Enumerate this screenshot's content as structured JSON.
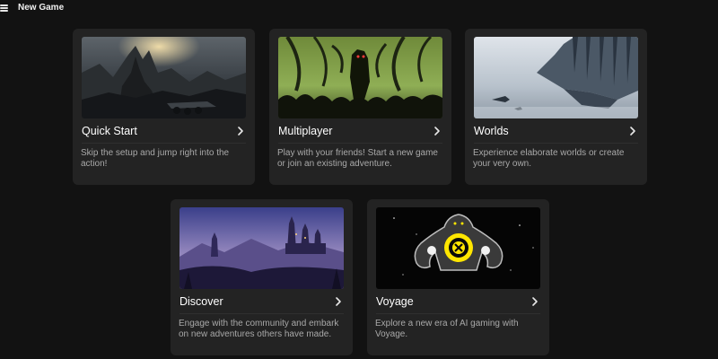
{
  "header": {
    "menu_icon": "hamburger-icon",
    "title": "New Game"
  },
  "cards": [
    {
      "title": "Quick Start",
      "description": "Skip the setup and jump right into the action!",
      "image": "dark-mountain-city-illustration",
      "chevron_icon": "chevron-right-icon"
    },
    {
      "title": "Multiplayer",
      "description": "Play with your friends! Start a new game or join an existing adventure.",
      "image": "tentacle-monster-crowd-illustration",
      "chevron_icon": "chevron-right-icon"
    },
    {
      "title": "Worlds",
      "description": "Experience elaborate worlds or create your very own.",
      "image": "floating-city-airships-illustration",
      "chevron_icon": "chevron-right-icon"
    },
    {
      "title": "Discover",
      "description": "Engage with the community and embark on new adventures others have made.",
      "image": "purple-castle-landscape-illustration",
      "chevron_icon": "chevron-right-icon"
    },
    {
      "title": "Voyage",
      "description": "Explore a new era of AI gaming with Voyage.",
      "image": "voyage-ghost-emblem-illustration",
      "chevron_icon": "chevron-right-icon"
    }
  ]
}
